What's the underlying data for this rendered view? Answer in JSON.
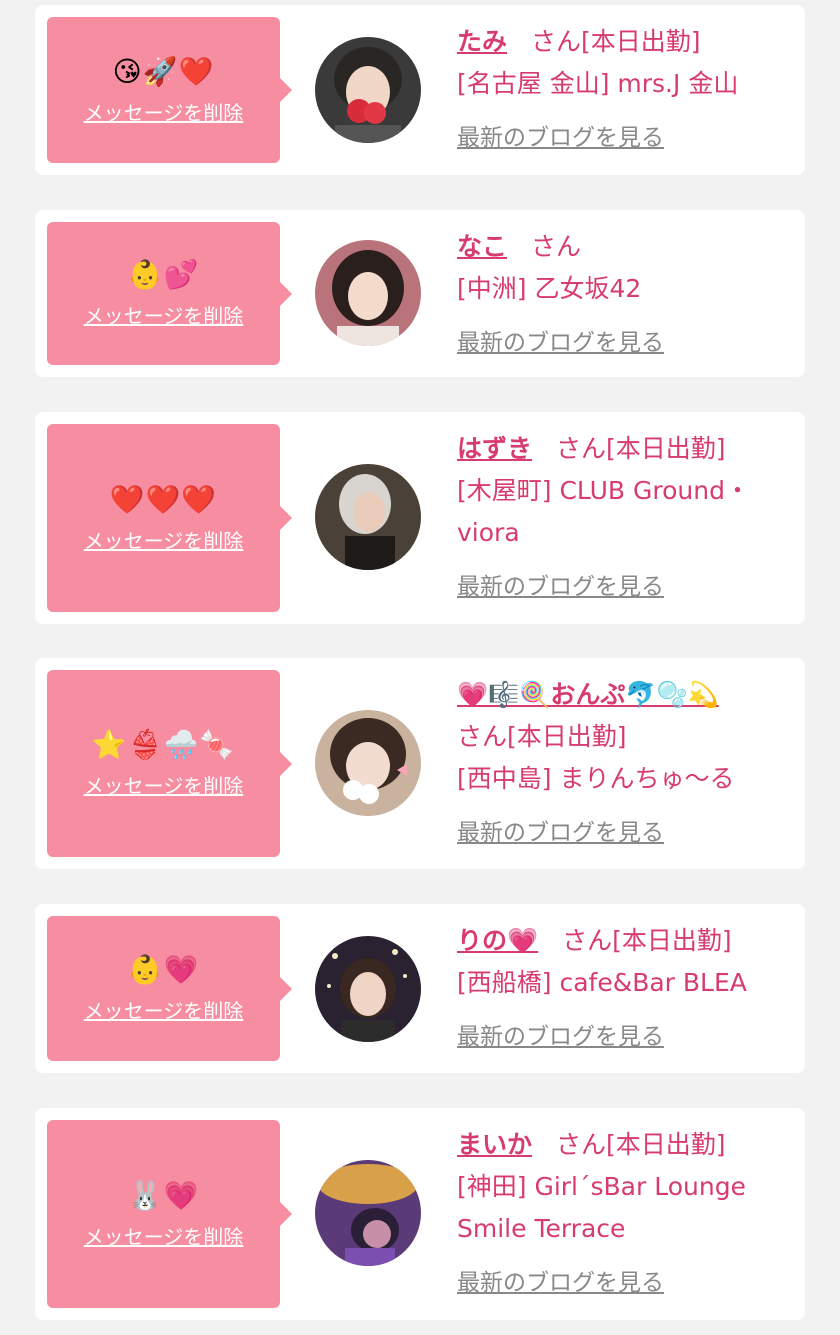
{
  "delete_label": "メッセージを削除",
  "honorific": "さん",
  "blog_label": "最新のブログを見る",
  "colors": {
    "bubble": "#f78da0",
    "accent": "#d83b6e",
    "muted": "#888888"
  },
  "messages": [
    {
      "emoji": "😘🚀❤️",
      "name": "たみ",
      "status": "[本日出勤]",
      "shop": "[名古屋 金山] mrs.J 金山"
    },
    {
      "emoji": "👶💕",
      "name": "なこ",
      "status": "",
      "shop": "[中洲] 乙女坂42"
    },
    {
      "emoji": "❤️❤️❤️",
      "name": "はずき",
      "status": "[本日出勤]",
      "shop": "[木屋町] CLUB Ground・viora"
    },
    {
      "emoji": "⭐👙🌧️🍬",
      "name": "💗🎼🍭おんぷ🐬🫧💫",
      "status": "[本日出勤]",
      "shop": "[西中島] まりんちゅ～る"
    },
    {
      "emoji": "👶💗",
      "name": "りの💗",
      "status": "[本日出勤]",
      "shop": "[西船橋] cafe&Bar BLEA"
    },
    {
      "emoji": "🐰💗",
      "name": "まいか",
      "status": "[本日出勤]",
      "shop": "[神田] Girl´sBar Lounge Smile Terrace"
    }
  ]
}
